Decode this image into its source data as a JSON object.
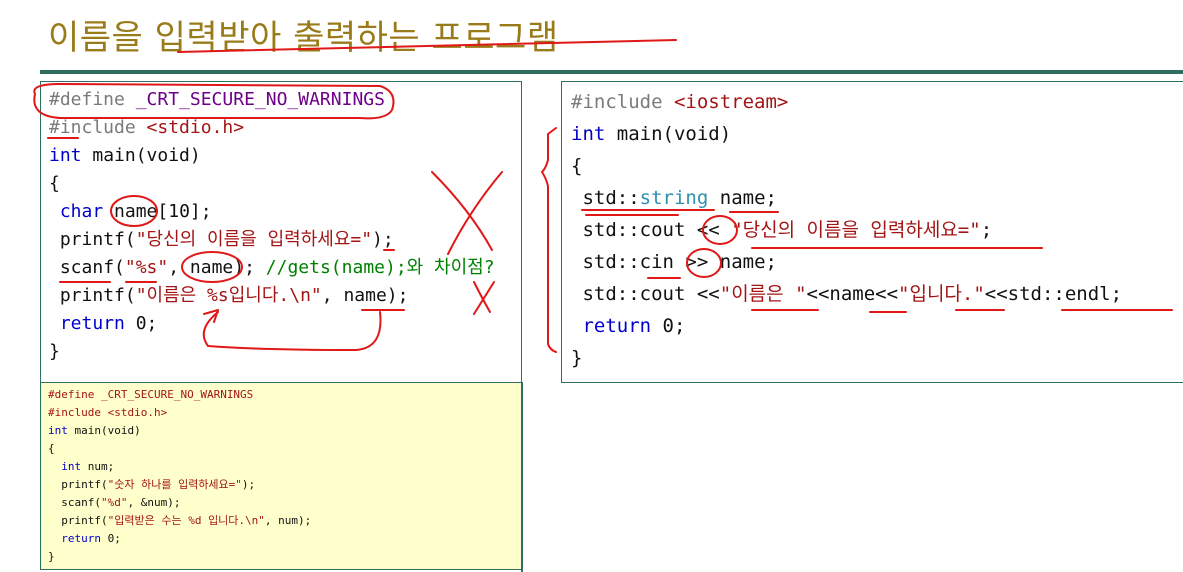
{
  "title": "이름을 입력받아 출력하는 프로그램",
  "left_code": {
    "line1_pp": "#define",
    "line1_macro": "_CRT_SECURE_NO_WARNINGS",
    "line2_pp": "#include",
    "line2_header": "<stdio.h>",
    "line3_kw": "int",
    "line3_rest": "main(void)",
    "line4": "{",
    "line5_kw": "char",
    "line5_rest": "name[10];",
    "line6_fn": "printf(",
    "line6_str": "\"당신의 이름을 입력하세요=\"",
    "line6_end": ");",
    "line7_fn": "scanf(",
    "line7_str": "\"%s\"",
    "line7_mid": ", name);",
    "line7_cmt": "//gets(name);와 차이점?",
    "line8_fn": "printf(",
    "line8_str": "\"이름은 %s입니다.\\n\"",
    "line8_end": ", name);",
    "line9_kw": "return",
    "line9_rest": "0;",
    "line10": "}"
  },
  "small_code": {
    "line1_pp": "#define",
    "line1_macro": "_CRT_SECURE_NO_WARNINGS",
    "line2_pp": "#include",
    "line2_header": "<stdio.h>",
    "line3_kw": "int",
    "line3_rest": "main(void)",
    "line4": "{",
    "line5_kw": "int",
    "line5_rest": "num;",
    "line6_fn": "printf(",
    "line6_str": "\"숫자 하나를 입력하세요=\"",
    "line6_end": ");",
    "line7_fn": "scanf(",
    "line7_str": "\"%d\"",
    "line7_end": ", &num);",
    "line8_fn": "printf(",
    "line8_str": "\"입력받은 수는 %d 입니다.\\n\"",
    "line8_end": ", num);",
    "line9_kw": "return",
    "line9_rest": "0;",
    "line10": "}"
  },
  "right_code": {
    "line1_pp": "#include",
    "line1_header": "<iostream>",
    "line2_kw": "int",
    "line2_rest": "main(void)",
    "line3": "{",
    "line4_ns": "std::",
    "line4_type": "string",
    "line4_rest": "name;",
    "line5_a": "std::cout",
    "line5_op": "<<",
    "line5_str": "\"당신의 이름을 입력하세요=\"",
    "line5_end": ";",
    "line6_a": "std::cin",
    "line6_op": ">>",
    "line6_rest": "name;",
    "line7_a": "std::cout",
    "line7_op1": "<<",
    "line7_str1": "\"이름은 \"",
    "line7_op2": "<<name<<",
    "line7_str2": "\"입니다.\"",
    "line7_op3": "<<std::endl;",
    "line8_kw": "return",
    "line8_rest": "0;",
    "line9": "}"
  }
}
